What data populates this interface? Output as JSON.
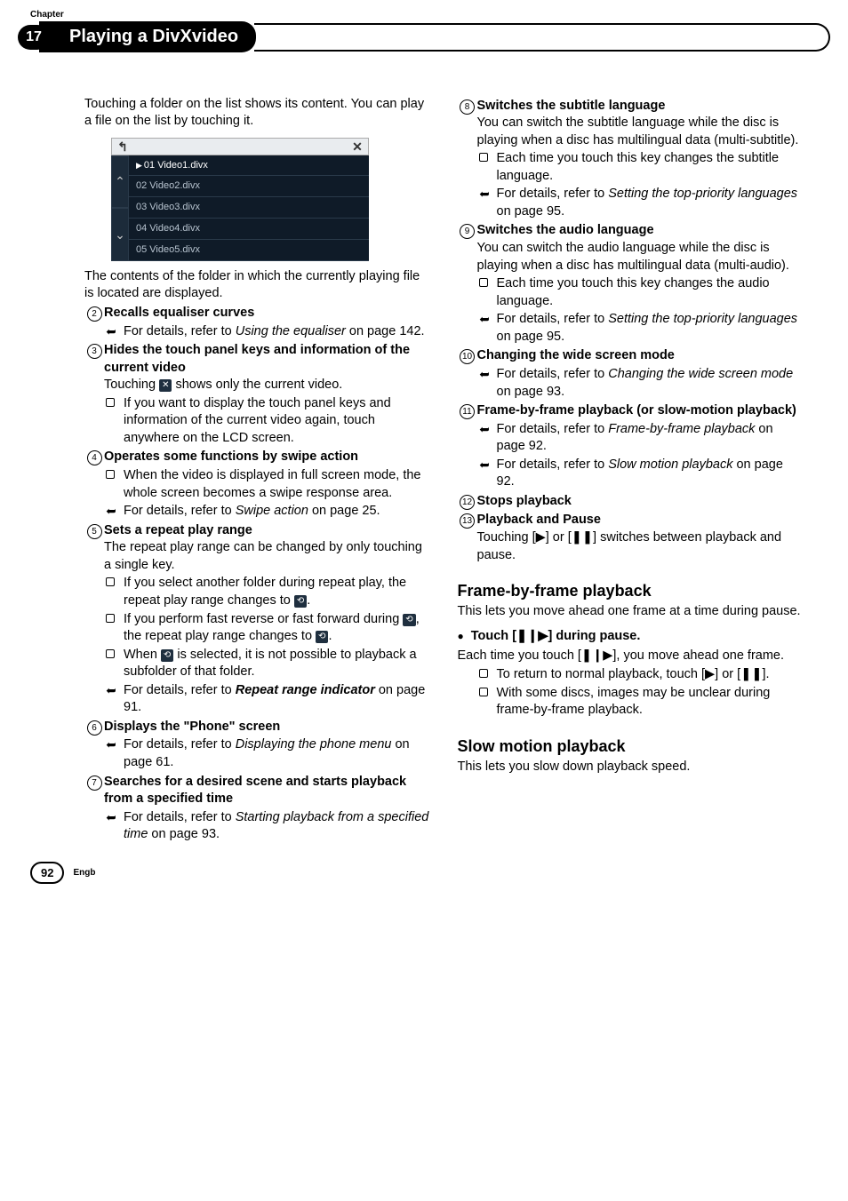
{
  "header": {
    "chapter_label": "Chapter",
    "chapter_number": "17",
    "title": "Playing a DivXvideo"
  },
  "left": {
    "intro": "Touching a folder on the list shows its content. You can play a file on the list by touching it.",
    "fileui": {
      "back": "↰",
      "close": "✕",
      "up": "⌃",
      "down": "⌄",
      "rows": [
        {
          "play": "▶",
          "label": "01 Video1.divx"
        },
        {
          "play": "",
          "label": "02 Video2.divx"
        },
        {
          "play": "",
          "label": "03 Video3.divx"
        },
        {
          "play": "",
          "label": "04 Video4.divx"
        },
        {
          "play": "",
          "label": "05 Video5.divx"
        }
      ]
    },
    "after_ui": "The contents of the folder in which the currently playing file is located are displayed.",
    "items": {
      "2": {
        "title": "Recalls equaliser curves",
        "ref_a": "For details, refer to ",
        "ref_b": "Using the equaliser",
        "ref_c": " on page 142."
      },
      "3": {
        "title": "Hides the touch panel keys and information of the current video",
        "line_a": "Touching ",
        "line_b": " shows only the current video.",
        "icon": "✕",
        "sq": "If you want to display the touch panel keys and information of the current video again, touch anywhere on the LCD screen."
      },
      "4": {
        "title": "Operates some functions by swipe action",
        "sq": "When the video is displayed in full screen mode, the whole screen becomes a swipe response area.",
        "ref_a": "For details, refer to ",
        "ref_b": "Swipe action",
        "ref_c": " on page 25."
      },
      "5": {
        "title": "Sets a repeat play range",
        "desc": "The repeat play range can be changed by only touching a single key.",
        "sq1_a": "If you select another folder during repeat play, the repeat play range changes to ",
        "sq1_icon": "⟲",
        "sq1_b": ".",
        "sq2_a": "If you perform fast reverse or fast forward during ",
        "sq2_i1": "⟲",
        "sq2_b": ", the repeat play range changes to ",
        "sq2_i2": "⟲",
        "sq2_c": ".",
        "sq3_a": "When ",
        "sq3_i": "⟲",
        "sq3_b": " is selected, it is not possible to playback a subfolder of that folder.",
        "ref_a": "For details, refer to ",
        "ref_b": "Repeat range indicator",
        "ref_c": " on page 91."
      },
      "6": {
        "title": "Displays the \"Phone\" screen",
        "ref_a": "For details, refer to ",
        "ref_b": "Displaying the phone menu",
        "ref_c": " on page 61."
      },
      "7": {
        "title": "Searches for a desired scene and starts playback from a specified time",
        "ref_a": "For details, refer to ",
        "ref_b": "Starting playback from a specified time",
        "ref_c": " on page 93."
      }
    }
  },
  "right": {
    "items": {
      "8": {
        "title": "Switches the subtitle language",
        "desc": "You can switch the subtitle language while the disc is playing when a disc has multilingual data (multi-subtitle).",
        "sq": "Each time you touch this key changes the subtitle language.",
        "ref_a": "For details, refer to ",
        "ref_b": "Setting the top-priority languages",
        "ref_c": " on page 95."
      },
      "9": {
        "title": "Switches the audio language",
        "desc": "You can switch the audio language while the disc is playing when a disc has multilingual data (multi-audio).",
        "sq": "Each time you touch this key changes the audio language.",
        "ref_a": "For details, refer to ",
        "ref_b": "Setting the top-priority languages",
        "ref_c": " on page 95."
      },
      "10": {
        "title": "Changing the wide screen mode",
        "ref_a": "For details, refer to ",
        "ref_b": "Changing the wide screen mode",
        "ref_c": " on page 93."
      },
      "11": {
        "title": "Frame-by-frame playback (or slow-motion playback)",
        "ref1_a": "For details, refer to ",
        "ref1_b": "Frame-by-frame playback",
        "ref1_c": " on page 92.",
        "ref2_a": "For details, refer to ",
        "ref2_b": "Slow motion playback",
        "ref2_c": " on page 92."
      },
      "12": {
        "title": "Stops playback"
      },
      "13": {
        "title": "Playback and Pause",
        "desc": "Touching [▶] or [❚❚] switches between playback and pause."
      }
    },
    "fbf": {
      "heading": "Frame-by-frame playback",
      "intro": "This lets you move ahead one frame at a time during pause.",
      "step": "Touch [❚❙▶] during pause.",
      "after": "Each time you touch [❚❙▶], you move ahead one frame.",
      "sq1": "To return to normal playback, touch [▶] or [❚❚].",
      "sq2": "With some discs, images may be unclear during frame-by-frame playback."
    },
    "slow": {
      "heading": "Slow motion playback",
      "intro": "This lets you slow down playback speed."
    }
  },
  "footer": {
    "page": "92",
    "lang": "Engb"
  }
}
